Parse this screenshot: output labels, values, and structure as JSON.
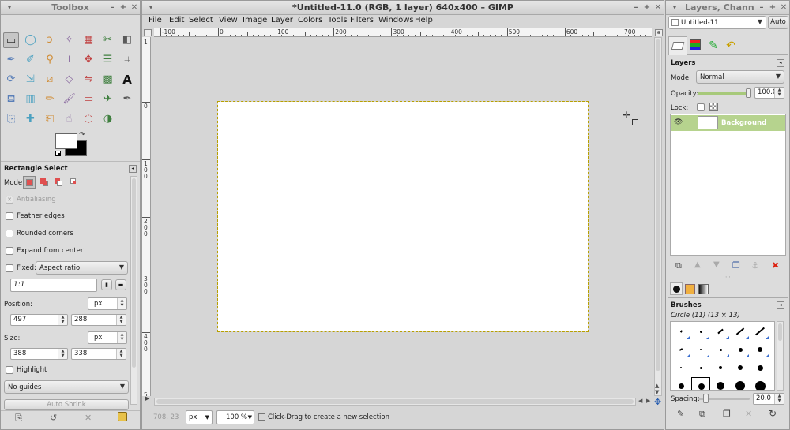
{
  "toolbox": {
    "title": "Toolbox",
    "tools": [
      "rect-select",
      "ellipse-select",
      "free-select",
      "fuzzy-select",
      "select-by-color",
      "scissors-select",
      "foreground-select",
      "paths",
      "color-picker",
      "zoom",
      "measure",
      "move",
      "alignment",
      "crop",
      "rotate",
      "scale",
      "shear",
      "perspective",
      "flip",
      "cage-transform",
      "text",
      "bucket-fill",
      "blend",
      "pencil",
      "paintbrush",
      "eraser",
      "airbrush",
      "ink",
      "clone",
      "heal",
      "perspective-clone",
      "smudge",
      "blur-sharpen",
      "dodge-burn"
    ],
    "options": {
      "title": "Rectangle Select",
      "mode_label": "Mode:",
      "antialiasing": "Antialiasing",
      "feather": "Feather edges",
      "rounded": "Rounded corners",
      "expand": "Expand from center",
      "fixed": "Fixed:",
      "fixed_value": "Aspect ratio",
      "ratio": "1:1",
      "position_label": "Position:",
      "unit": "px",
      "pos_x": "497",
      "pos_y": "288",
      "size_label": "Size:",
      "size_w": "388",
      "size_h": "338",
      "highlight": "Highlight",
      "guides": "No guides",
      "auto_shrink": "Auto Shrink"
    }
  },
  "image_window": {
    "title": "*Untitled-11.0 (RGB, 1 layer) 640x400 – GIMP",
    "menu": [
      "File",
      "Edit",
      "Select",
      "View",
      "Image",
      "Layer",
      "Colors",
      "Tools",
      "Filters",
      "Windows",
      "Help"
    ],
    "ruler_h": [
      "-100",
      "0",
      "100",
      "200",
      "300",
      "400",
      "500",
      "600",
      "700"
    ],
    "ruler_v": [
      "0",
      "1\n0\n0",
      "2\n0\n0",
      "3\n0\n0",
      "4\n0\n0",
      "5"
    ],
    "status": {
      "coords": "708, 23",
      "unit": "px",
      "zoom": "100 %",
      "message": "Click-Drag to create a new selection"
    }
  },
  "dock": {
    "title": "Layers, Chann",
    "image_select": "Untitled-11",
    "auto": "Auto",
    "layers": {
      "title": "Layers",
      "mode_label": "Mode:",
      "mode": "Normal",
      "opacity_label": "Opacity:",
      "opacity": "100.0",
      "lock_label": "Lock:",
      "items": [
        {
          "name": "Background"
        }
      ]
    },
    "brushes": {
      "title": "Brushes",
      "current": "Circle (11) (13 × 13)",
      "spacing_label": "Spacing:",
      "spacing": "20.0"
    }
  },
  "colors": {
    "accent": "#b6d38e",
    "selection": "#c7a000"
  }
}
